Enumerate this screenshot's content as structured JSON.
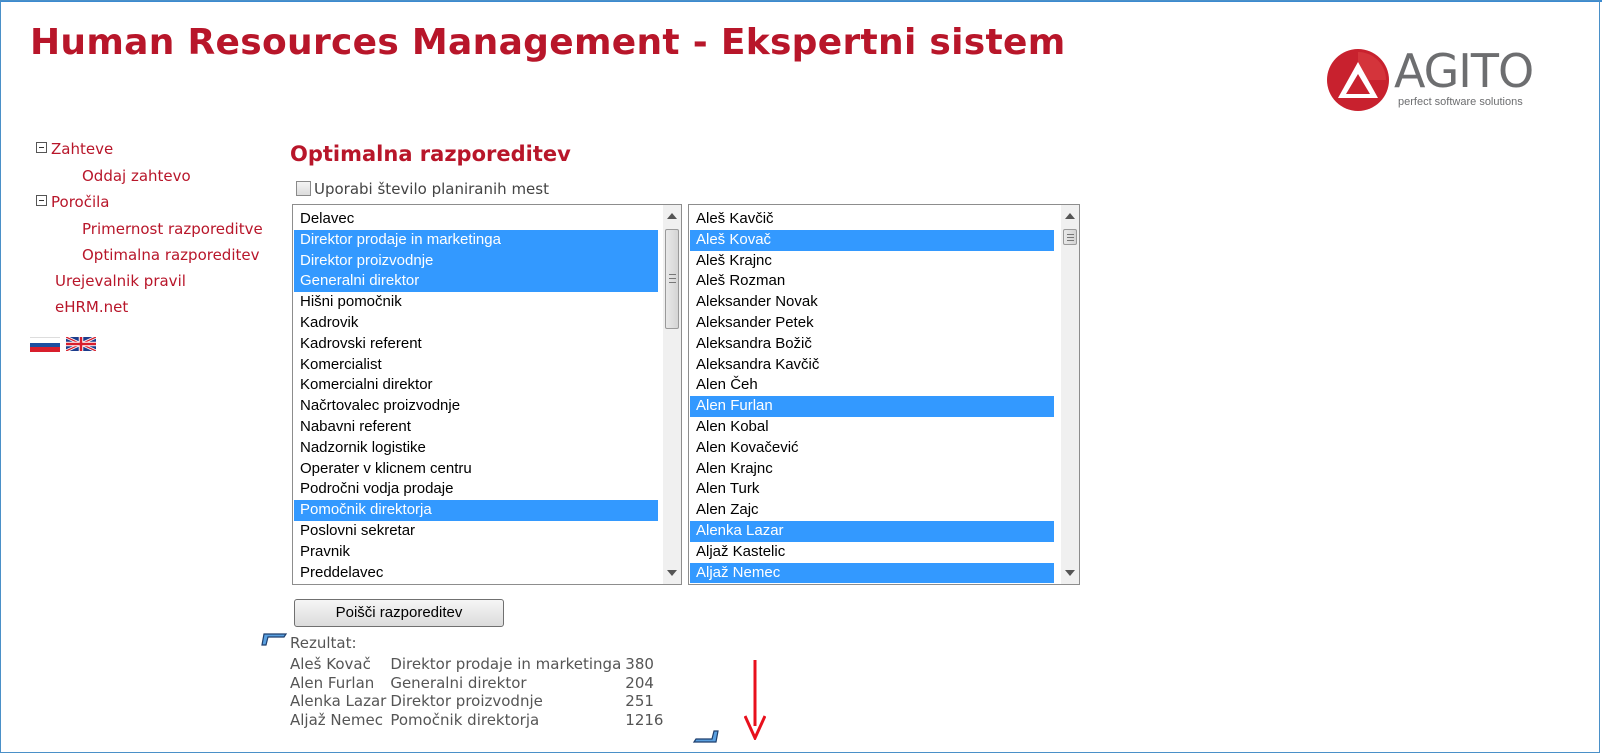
{
  "header": {
    "title": "Human Resources Management - Ekspertni sistem",
    "logo_text": "AGITO",
    "logo_tagline": "perfect software solutions"
  },
  "nav": {
    "zahteve": "Zahteve",
    "oddaj": "Oddaj zahtevo",
    "porocila": "Poročila",
    "primernost": "Primernost razporeditve",
    "optimalna": "Optimalna razporeditev",
    "urejevalnik": "Urejevalnik pravil",
    "ehrm": "eHRM.net"
  },
  "languages": [
    "Slovenščina",
    "English"
  ],
  "main": {
    "section_title": "Optimalna razporeditev",
    "checkbox_label": "Uporabi število planiranih mest",
    "checkbox_checked": false,
    "positions": [
      {
        "label": "Delavec",
        "selected": false
      },
      {
        "label": "Direktor prodaje in marketinga",
        "selected": true
      },
      {
        "label": "Direktor proizvodnje",
        "selected": true
      },
      {
        "label": "Generalni direktor",
        "selected": true
      },
      {
        "label": "Hišni pomočnik",
        "selected": false
      },
      {
        "label": "Kadrovik",
        "selected": false
      },
      {
        "label": "Kadrovski referent",
        "selected": false
      },
      {
        "label": "Komercialist",
        "selected": false
      },
      {
        "label": "Komercialni direktor",
        "selected": false
      },
      {
        "label": "Načrtovalec proizvodnje",
        "selected": false
      },
      {
        "label": "Nabavni referent",
        "selected": false
      },
      {
        "label": "Nadzornik logistike",
        "selected": false
      },
      {
        "label": "Operater v klicnem centru",
        "selected": false
      },
      {
        "label": "Področni vodja prodaje",
        "selected": false
      },
      {
        "label": "Pomočnik direktorja",
        "selected": true
      },
      {
        "label": "Poslovni sekretar",
        "selected": false
      },
      {
        "label": "Pravnik",
        "selected": false
      },
      {
        "label": "Preddelavec",
        "selected": false
      }
    ],
    "employees": [
      {
        "label": "Aleš Kavčič",
        "selected": false
      },
      {
        "label": "Aleš Kovač",
        "selected": true
      },
      {
        "label": "Aleš Krajnc",
        "selected": false
      },
      {
        "label": "Aleš Rozman",
        "selected": false
      },
      {
        "label": "Aleksander Novak",
        "selected": false
      },
      {
        "label": "Aleksander Petek",
        "selected": false
      },
      {
        "label": "Aleksandra Božič",
        "selected": false
      },
      {
        "label": "Aleksandra Kavčič",
        "selected": false
      },
      {
        "label": "Alen Čeh",
        "selected": false
      },
      {
        "label": "Alen Furlan",
        "selected": true
      },
      {
        "label": "Alen Kobal",
        "selected": false
      },
      {
        "label": "Alen Kovačević",
        "selected": false
      },
      {
        "label": "Alen Krajnc",
        "selected": false
      },
      {
        "label": "Alen Turk",
        "selected": false
      },
      {
        "label": "Alen Zajc",
        "selected": false
      },
      {
        "label": "Alenka Lazar",
        "selected": true
      },
      {
        "label": "Aljaž Kastelic",
        "selected": false
      },
      {
        "label": "Aljaž Nemec",
        "selected": true
      }
    ],
    "button_label": "Poišči razporeditev",
    "result_label": "Rezultat:",
    "results": [
      {
        "name": "Aleš Kovač",
        "position": "Direktor prodaje in marketinga",
        "score": "380"
      },
      {
        "name": "Alen Furlan",
        "position": "Generalni direktor",
        "score": "204"
      },
      {
        "name": "Alenka Lazar",
        "position": "Direktor proizvodnje",
        "score": "251"
      },
      {
        "name": "Aljaž Nemec",
        "position": "Pomočnik direktorja",
        "score": "1216"
      }
    ]
  },
  "colors": {
    "brand_red": "#b8162a",
    "selection_blue": "#3399ff",
    "frame_blue": "#3b8ad0",
    "annotation_arrow": "#e8101c"
  }
}
